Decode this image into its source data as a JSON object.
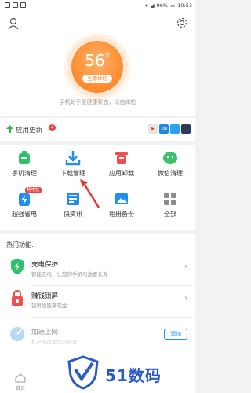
{
  "status_bar": {
    "battery": "96%",
    "time": "10:53"
  },
  "health": {
    "score": "56",
    "score_unit": "分",
    "check_button": "立即体检",
    "tip": "手机处于亚健康状态，点击体检"
  },
  "updates": {
    "label": "应用更新",
    "count": "4",
    "mini_apps": [
      "Top",
      "",
      "",
      "⬤"
    ]
  },
  "tools": [
    {
      "label": "手机清理",
      "icon": "phone-clean-icon"
    },
    {
      "label": "下载管理",
      "icon": "download-icon"
    },
    {
      "label": "应用卸载",
      "icon": "uninstall-icon"
    },
    {
      "label": "微信清理",
      "icon": "wechat-icon"
    },
    {
      "label": "超强省电",
      "icon": "power-save-icon",
      "pill": "耗电快"
    },
    {
      "label": "快资讯",
      "icon": "news-icon"
    },
    {
      "label": "相册备份",
      "icon": "album-icon"
    },
    {
      "label": "全部",
      "icon": "all-icon"
    }
  ],
  "hot": {
    "title": "热门功能:",
    "features": [
      {
        "title": "充电保护",
        "subtitle": "智能充电，让您的手机电池更长寿"
      },
      {
        "title": "赚钱锁屏",
        "subtitle": "锁屏也能拿现金"
      },
      {
        "title": "加速上网",
        "subtitle": "打开网页极快又安全",
        "button": "添加"
      }
    ]
  },
  "nav": {
    "home": "首页"
  },
  "watermark": {
    "text": "51数码"
  }
}
